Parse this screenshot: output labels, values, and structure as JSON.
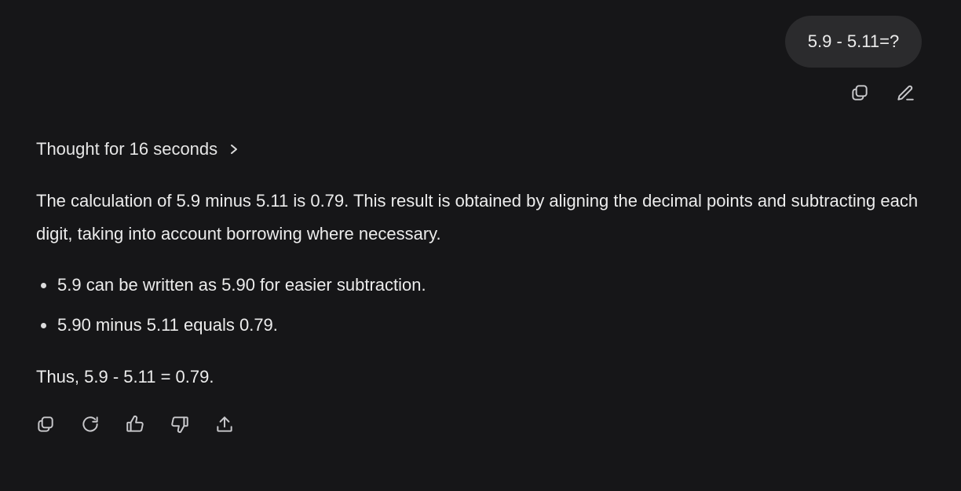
{
  "user_message": {
    "text": "5.9 - 5.11=?"
  },
  "user_actions": {
    "copy_icon": "copy-icon",
    "edit_icon": "pencil-icon"
  },
  "thought": {
    "label": "Thought for 16 seconds",
    "icon": "chevron-right-icon"
  },
  "answer": {
    "paragraph": "The calculation of 5.9 minus 5.11 is 0.79. This result is obtained by aligning the decimal points and subtracting each digit, taking into account borrowing where necessary.",
    "bullets": [
      "5.9 can be written as 5.90 for easier subtraction.",
      "5.90 minus 5.11 equals 0.79."
    ],
    "conclusion": "Thus, 5.9 - 5.11 = 0.79."
  },
  "answer_actions": {
    "icons": [
      "copy-icon",
      "regenerate-icon",
      "thumbs-up-icon",
      "thumbs-down-icon",
      "share-icon"
    ]
  },
  "colors": {
    "background": "#161618",
    "user_bubble": "#2b2b2d",
    "text": "#ececec",
    "icon": "#c9c9cc"
  }
}
